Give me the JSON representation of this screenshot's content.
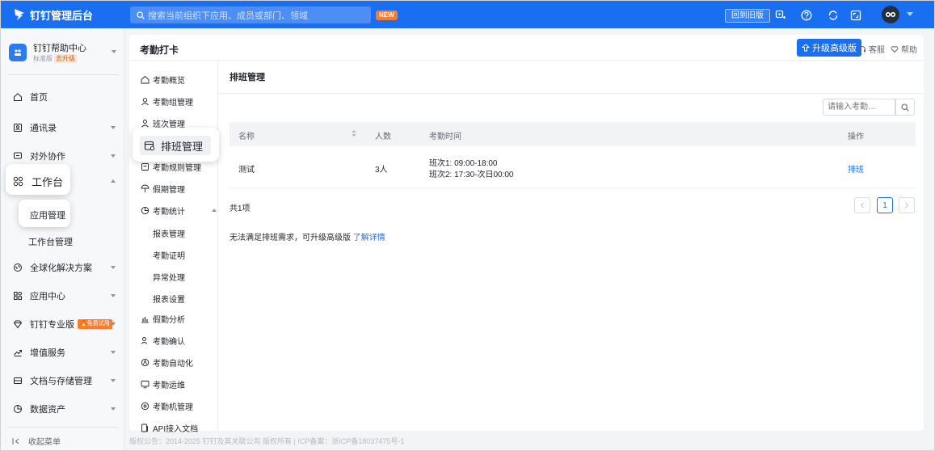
{
  "topbar": {
    "app_name": "钉钉管理后台",
    "search_placeholder": "搜索当前组织下应用、成员或部门、领域",
    "new_badge": "NEW",
    "old_version": "回到旧版"
  },
  "sidebar": {
    "org_name": "钉钉帮助中心",
    "org_edition": "标准版",
    "org_upgrade": "去升级",
    "items": [
      {
        "label": "首页"
      },
      {
        "label": "通讯录"
      },
      {
        "label": "对外协作"
      },
      {
        "label": "工作台"
      },
      {
        "label": "全球化解决方案"
      },
      {
        "label": "应用中心"
      },
      {
        "label": "钉钉专业版"
      },
      {
        "label": "增值服务"
      },
      {
        "label": "文档与存储管理"
      },
      {
        "label": "数据资产"
      }
    ],
    "pro_badge": "🔥免费试用",
    "sub_items": [
      "应用管理",
      "工作台管理"
    ],
    "collapse": "收起菜单"
  },
  "main": {
    "title": "考勤打卡",
    "upgrade_btn": "升级高级版",
    "service": "客服",
    "help": "帮助"
  },
  "subnav": {
    "items": [
      "考勤概览",
      "考勤组管理",
      "班次管理",
      "排班管理",
      "考勤规则管理",
      "假期管理",
      "考勤统计",
      "假勤分析",
      "考勤确认",
      "考勤自动化",
      "考勤运维",
      "考勤机管理",
      "API接入文档"
    ],
    "stats_children": [
      "报表管理",
      "考勤证明",
      "异常处理",
      "报表设置"
    ]
  },
  "content": {
    "title": "排班管理",
    "search_placeholder": "请输入考勤…",
    "columns": [
      "名称",
      "人数",
      "考勤时间",
      "操作"
    ],
    "rows": [
      {
        "name": "测试",
        "count": "3人",
        "time1": "班次1: 09:00-18:00",
        "time2": "班次2: 17:30-次日00:00",
        "action": "排班"
      }
    ],
    "total": "共1项",
    "page": "1",
    "tip_text": "无法满足排班需求，可升级高级版",
    "tip_link": "了解详情"
  },
  "footer": "版权公告：2014-2025 钉钉及其关联公司 版权所有 | ICP备案：浙ICP备18037475号-1"
}
